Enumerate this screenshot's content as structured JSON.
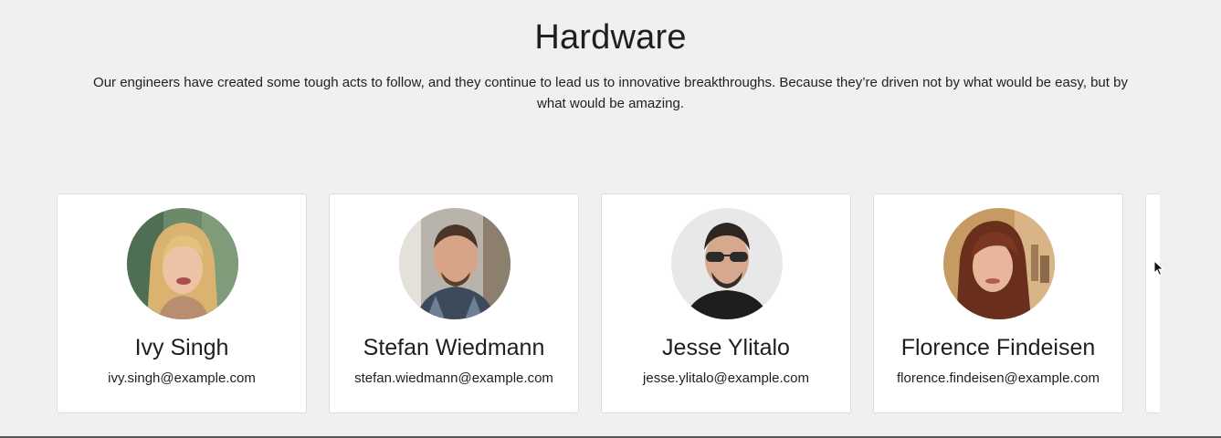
{
  "section": {
    "title": "Hardware",
    "description": "Our engineers have created some tough acts to follow, and they continue to lead us to innovative breakthroughs. Because they’re driven not by what would be easy, but by what would be amazing."
  },
  "team": [
    {
      "name": "Ivy Singh",
      "email": "ivy.singh@example.com"
    },
    {
      "name": "Stefan Wiedmann",
      "email": "stefan.wiedmann@example.com"
    },
    {
      "name": "Jesse Ylitalo",
      "email": "jesse.ylitalo@example.com"
    },
    {
      "name": "Florence Findeisen",
      "email": "florence.findeisen@example.com"
    }
  ],
  "icons": {
    "cursor": "mouse-pointer-icon"
  }
}
